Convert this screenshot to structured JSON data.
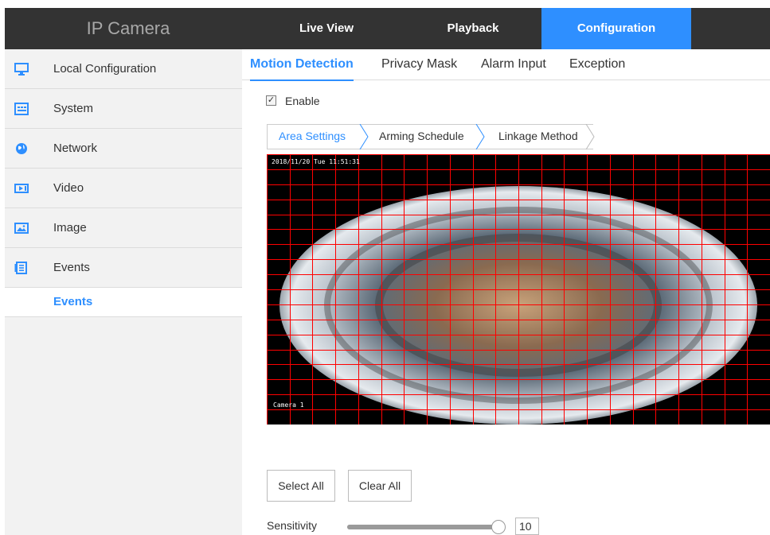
{
  "header": {
    "brand": "IP Camera",
    "nav": [
      {
        "label": "Live View",
        "active": false
      },
      {
        "label": "Playback",
        "active": false
      },
      {
        "label": "Configuration",
        "active": true
      }
    ],
    "accent_color": "#2e8fff",
    "bar_color": "#333333"
  },
  "sidebar": {
    "items": [
      {
        "label": "Local Configuration",
        "icon": "monitor-icon"
      },
      {
        "label": "System",
        "icon": "system-icon"
      },
      {
        "label": "Network",
        "icon": "globe-icon"
      },
      {
        "label": "Video",
        "icon": "video-icon"
      },
      {
        "label": "Image",
        "icon": "image-icon"
      },
      {
        "label": "Events",
        "icon": "events-icon"
      }
    ],
    "active_sub": "Events"
  },
  "tabs": [
    {
      "label": "Motion Detection",
      "active": true
    },
    {
      "label": "Privacy Mask",
      "active": false
    },
    {
      "label": "Alarm Input",
      "active": false
    },
    {
      "label": "Exception",
      "active": false
    }
  ],
  "enable": {
    "label": "Enable",
    "checked": true
  },
  "steps": [
    {
      "label": "Area Settings",
      "active": true
    },
    {
      "label": "Arming Schedule",
      "active": false
    },
    {
      "label": "Linkage Method",
      "active": false
    }
  ],
  "video": {
    "timestamp": "2018/11/20 Tue 11:51:31",
    "camera_label": "Camera 1",
    "grid_color": "#ff0000"
  },
  "buttons": {
    "select_all": "Select All",
    "clear_all": "Clear All"
  },
  "sensitivity": {
    "label": "Sensitivity",
    "value": "10",
    "fraction": 1.0
  }
}
